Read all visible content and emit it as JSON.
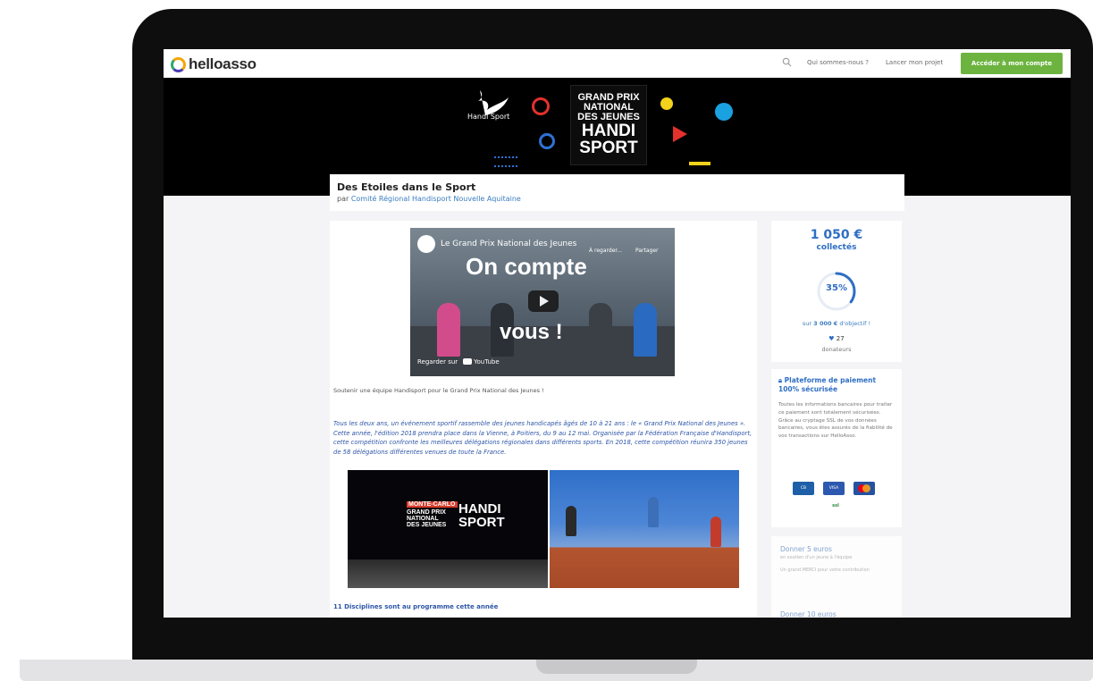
{
  "nav": {
    "logo_text": "helloasso",
    "link_who": "Qui sommes-nous ?",
    "link_launch": "Lancer mon projet",
    "account_button": "Accéder à mon compte"
  },
  "banner": {
    "logo_text": "Handi Sport",
    "title_line1": "GRAND PRIX",
    "title_line2": "NATIONAL",
    "title_line3": "DES JEUNES",
    "title_line4": "HANDI",
    "title_line5": "SPORT"
  },
  "campaign": {
    "title": "Des Etoiles dans le Sport",
    "by_prefix": "par",
    "organizer": "Comité Régional Handisport Nouvelle Aquitaine"
  },
  "video": {
    "title": "Le Grand Prix National des Jeunes",
    "watch_later": "À regarder...",
    "share": "Partager",
    "caption_line1": "On compte",
    "caption_line2": "vous !",
    "watch_on": "Regarder sur",
    "platform": "YouTube"
  },
  "content": {
    "intro": "Soutenir une équipe Handisport pour le Grand Prix National des Jeunes !",
    "paragraph": "Tous les deux ans, un événement sportif rassemble des jeunes handicapés âgés de 10 à 21 ans : le « Grand Prix National des Jeunes ». Cette année, l'édition 2018 prendra place dans la Vienne, à Poitiers, du 9 au 12 mai. Organisée par la Fédération Française d'Handisport, cette compétition confronte les meilleures délégations régionales dans différents sports. En 2018, cette compétition réunira 350 jeunes de 58 délégations différentes venues de toute la France.",
    "photo1_sign_small": "MONTE-CARLO",
    "photo1_sign_line1": "GRAND PRIX",
    "photo1_sign_line2": "NATIONAL",
    "photo1_sign_line3": "DES JEUNES",
    "photo1_sign_big1": "HANDI",
    "photo1_sign_big2": "SPORT",
    "disciplines_heading": "11 Disciplines sont au programme cette année"
  },
  "funding": {
    "amount": "1 050 €",
    "collected_label": "collectés",
    "percent": "35%",
    "progress_fraction": 0.35,
    "objective_prefix": "sur",
    "objective_amount": "3 000 €",
    "objective_suffix": "d'objectif !",
    "donors_count": "27",
    "donors_label": "donateurs"
  },
  "security": {
    "title": "Plateforme de paiement 100% sécurisée",
    "text": "Toutes les informations bancaires pour traiter ce paiement sont totalement sécurisées. Grâce au cryptage SSL de vos données bancaires, vous êtes assurés de la fiabilité de vos transactions sur HelloAsso.",
    "card_cb": "CB",
    "card_visa": "VISA",
    "card_extra": "ssl"
  },
  "donations": {
    "option1_title": "Donner 5 euros",
    "option1_sub": "en soutien d'un jeune à l'équipe",
    "option1_desc": "Un grand MERCI pour votre contribution",
    "option2_title": "Donner 10 euros"
  },
  "colors": {
    "accent_green": "#6cb43f",
    "accent_blue": "#2e6ec4",
    "link_blue": "#3b7dbf"
  }
}
